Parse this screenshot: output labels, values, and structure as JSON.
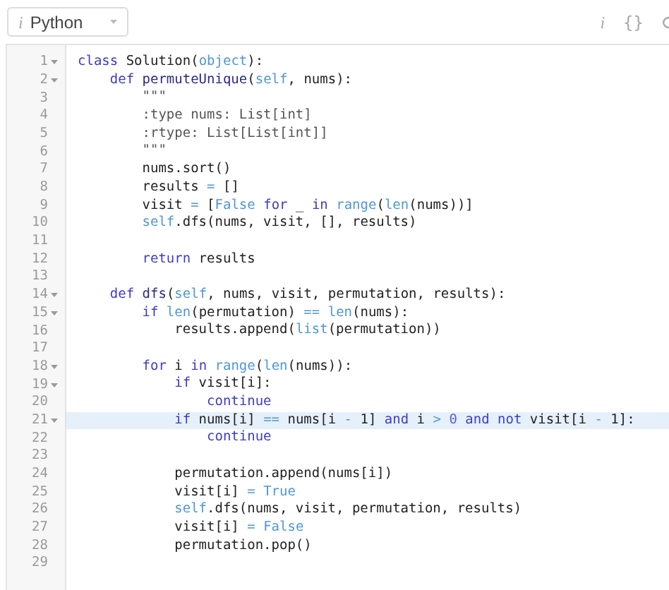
{
  "toolbar": {
    "language_select": {
      "icon_text": "i",
      "value": "Python"
    },
    "buttons": [
      "i",
      "{}"
    ]
  },
  "editor": {
    "lines": [
      {
        "number": "1",
        "fold": true,
        "active": false,
        "tokens": [
          {
            "kind": "keyword",
            "text": "class "
          },
          {
            "kind": "plain",
            "text": "Solution("
          },
          {
            "kind": "builtin",
            "text": "object"
          },
          {
            "kind": "plain",
            "text": "):"
          }
        ]
      },
      {
        "number": "2",
        "fold": true,
        "active": false,
        "tokens": [
          {
            "kind": "keyword",
            "text": "    def "
          },
          {
            "kind": "defname",
            "text": "permuteUnique"
          },
          {
            "kind": "plain",
            "text": "("
          },
          {
            "kind": "builtin",
            "text": "self"
          },
          {
            "kind": "plain",
            "text": ", nums):"
          }
        ]
      },
      {
        "number": "3",
        "fold": false,
        "active": false,
        "tokens": [
          {
            "kind": "string",
            "text": "        \"\"\""
          }
        ]
      },
      {
        "number": "4",
        "fold": false,
        "active": false,
        "tokens": [
          {
            "kind": "string",
            "text": "        :type nums: List[int]"
          }
        ]
      },
      {
        "number": "5",
        "fold": false,
        "active": false,
        "tokens": [
          {
            "kind": "string",
            "text": "        :rtype: List[List[int]]"
          }
        ]
      },
      {
        "number": "6",
        "fold": false,
        "active": false,
        "tokens": [
          {
            "kind": "string",
            "text": "        \"\"\""
          }
        ]
      },
      {
        "number": "7",
        "fold": false,
        "active": false,
        "tokens": [
          {
            "kind": "plain",
            "text": "        nums.sort()"
          }
        ]
      },
      {
        "number": "8",
        "fold": false,
        "active": false,
        "tokens": [
          {
            "kind": "plain",
            "text": "        results "
          },
          {
            "kind": "operator",
            "text": "= "
          },
          {
            "kind": "plain",
            "text": "[]"
          }
        ]
      },
      {
        "number": "9",
        "fold": false,
        "active": false,
        "tokens": [
          {
            "kind": "plain",
            "text": "        visit "
          },
          {
            "kind": "operator",
            "text": "= "
          },
          {
            "kind": "plain",
            "text": "["
          },
          {
            "kind": "builtin",
            "text": "False "
          },
          {
            "kind": "keyword",
            "text": "for "
          },
          {
            "kind": "plain",
            "text": "_ "
          },
          {
            "kind": "keyword",
            "text": "in "
          },
          {
            "kind": "builtin",
            "text": "range"
          },
          {
            "kind": "plain",
            "text": "("
          },
          {
            "kind": "builtin",
            "text": "len"
          },
          {
            "kind": "plain",
            "text": "(nums))]"
          }
        ]
      },
      {
        "number": "10",
        "fold": false,
        "active": false,
        "tokens": [
          {
            "kind": "builtin",
            "text": "        self"
          },
          {
            "kind": "plain",
            "text": ".dfs(nums, visit, [], results)"
          }
        ]
      },
      {
        "number": "11",
        "fold": false,
        "active": false
      },
      {
        "number": "12",
        "fold": false,
        "active": false,
        "tokens": [
          {
            "kind": "keyword",
            "text": "        return "
          },
          {
            "kind": "plain",
            "text": "results"
          }
        ]
      },
      {
        "number": "13",
        "fold": false,
        "active": false
      },
      {
        "number": "14",
        "fold": true,
        "active": false,
        "tokens": [
          {
            "kind": "keyword",
            "text": "    def "
          },
          {
            "kind": "defname",
            "text": "dfs"
          },
          {
            "kind": "plain",
            "text": "("
          },
          {
            "kind": "builtin",
            "text": "self"
          },
          {
            "kind": "plain",
            "text": ", nums, visit, permutation, results):"
          }
        ]
      },
      {
        "number": "15",
        "fold": true,
        "active": false,
        "tokens": [
          {
            "kind": "keyword",
            "text": "        if "
          },
          {
            "kind": "builtin",
            "text": "len"
          },
          {
            "kind": "plain",
            "text": "(permutation) "
          },
          {
            "kind": "operator",
            "text": "== "
          },
          {
            "kind": "builtin",
            "text": "len"
          },
          {
            "kind": "plain",
            "text": "(nums):"
          }
        ]
      },
      {
        "number": "16",
        "fold": false,
        "active": false,
        "tokens": [
          {
            "kind": "plain",
            "text": "            results.append("
          },
          {
            "kind": "builtin",
            "text": "list"
          },
          {
            "kind": "plain",
            "text": "(permutation))"
          }
        ]
      },
      {
        "number": "17",
        "fold": false,
        "active": false
      },
      {
        "number": "18",
        "fold": true,
        "active": false,
        "tokens": [
          {
            "kind": "keyword",
            "text": "        for "
          },
          {
            "kind": "plain",
            "text": "i "
          },
          {
            "kind": "keyword",
            "text": "in "
          },
          {
            "kind": "builtin",
            "text": "range"
          },
          {
            "kind": "plain",
            "text": "("
          },
          {
            "kind": "builtin",
            "text": "len"
          },
          {
            "kind": "plain",
            "text": "(nums)):"
          }
        ]
      },
      {
        "number": "19",
        "fold": true,
        "active": false,
        "tokens": [
          {
            "kind": "keyword",
            "text": "            if "
          },
          {
            "kind": "plain",
            "text": "visit[i]:"
          }
        ]
      },
      {
        "number": "20",
        "fold": false,
        "active": false,
        "tokens": [
          {
            "kind": "keyword",
            "text": "                continue"
          }
        ]
      },
      {
        "number": "21",
        "fold": true,
        "active": true,
        "tokens": [
          {
            "kind": "keyword",
            "text": "            if "
          },
          {
            "kind": "plain",
            "text": "nums[i] "
          },
          {
            "kind": "operator",
            "text": "== "
          },
          {
            "kind": "plain",
            "text": "nums[i "
          },
          {
            "kind": "operator",
            "text": "- "
          },
          {
            "kind": "plain",
            "text": "1] "
          },
          {
            "kind": "keyword",
            "text": "and "
          },
          {
            "kind": "plain",
            "text": "i "
          },
          {
            "kind": "operator",
            "text": "> "
          },
          {
            "kind": "number",
            "text": "0 "
          },
          {
            "kind": "keyword",
            "text": "and not "
          },
          {
            "kind": "plain",
            "text": "visit[i "
          },
          {
            "kind": "operator",
            "text": "- "
          },
          {
            "kind": "plain",
            "text": "1]:"
          }
        ]
      },
      {
        "number": "22",
        "fold": false,
        "active": false,
        "tokens": [
          {
            "kind": "keyword",
            "text": "                continue"
          }
        ]
      },
      {
        "number": "23",
        "fold": false,
        "active": false
      },
      {
        "number": "24",
        "fold": false,
        "active": false,
        "tokens": [
          {
            "kind": "plain",
            "text": "            permutation.append(nums[i])"
          }
        ]
      },
      {
        "number": "25",
        "fold": false,
        "active": false,
        "tokens": [
          {
            "kind": "plain",
            "text": "            visit[i] "
          },
          {
            "kind": "operator",
            "text": "= "
          },
          {
            "kind": "builtin",
            "text": "True"
          }
        ]
      },
      {
        "number": "26",
        "fold": false,
        "active": false,
        "tokens": [
          {
            "kind": "builtin",
            "text": "            self"
          },
          {
            "kind": "plain",
            "text": ".dfs(nums, visit, permutation, results)"
          }
        ]
      },
      {
        "number": "27",
        "fold": false,
        "active": false,
        "tokens": [
          {
            "kind": "plain",
            "text": "            visit[i] "
          },
          {
            "kind": "operator",
            "text": "= "
          },
          {
            "kind": "builtin",
            "text": "False"
          }
        ]
      },
      {
        "number": "28",
        "fold": false,
        "active": false,
        "tokens": [
          {
            "kind": "plain",
            "text": "            permutation.pop()"
          }
        ]
      },
      {
        "number": "29",
        "fold": false,
        "active": false
      }
    ]
  }
}
